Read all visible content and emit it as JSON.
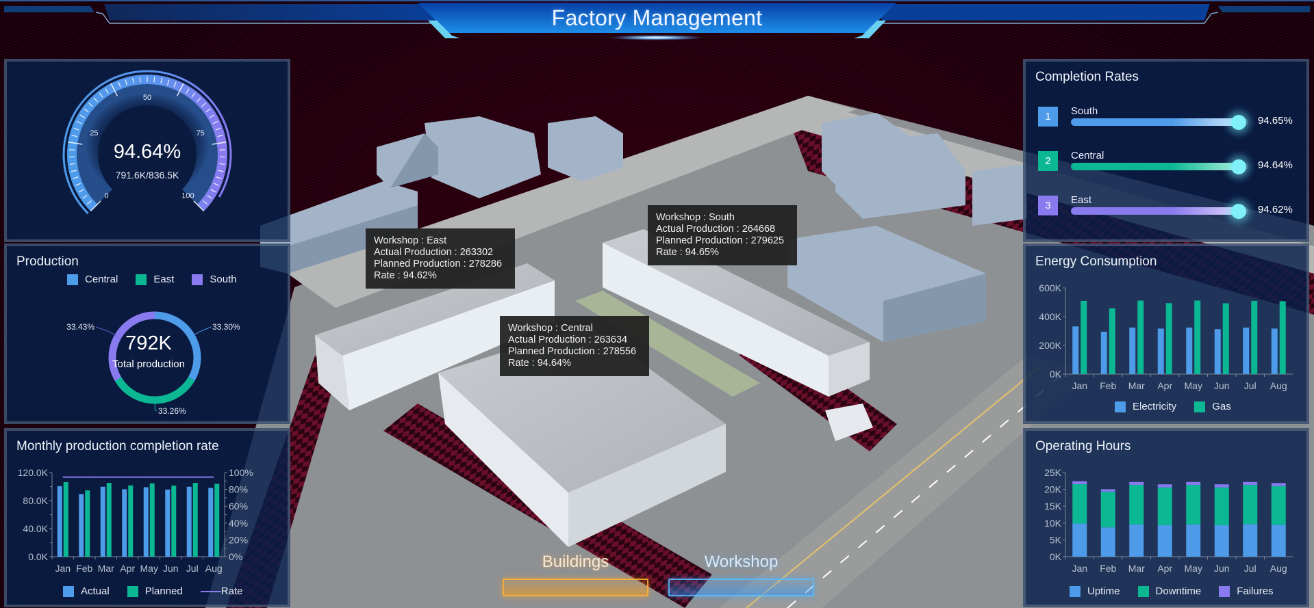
{
  "header": {
    "title": "Factory Management"
  },
  "colors": {
    "blue": "#4e9bea",
    "green": "#0cb894",
    "purple": "#8a7af0",
    "glow": "#7ff0f5",
    "panel": "#06204a"
  },
  "gauge": {
    "value_percent": 94.64,
    "value_label": "94.64%",
    "sub_label": "791.6K/836.5K",
    "ticks": [
      "0",
      "25",
      "50",
      "75",
      "100"
    ],
    "min": 0,
    "max": 100
  },
  "production": {
    "title": "Production",
    "legend": [
      "Central",
      "East",
      "South"
    ],
    "total_value": "792K",
    "total_label": "Total production",
    "slices": [
      {
        "name": "Central",
        "percent": 33.3,
        "label": "33.30%"
      },
      {
        "name": "East",
        "percent": 33.26,
        "label": "33.26%"
      },
      {
        "name": "South",
        "percent": 33.43,
        "label": "33.43%"
      }
    ]
  },
  "monthly": {
    "title": "Monthly production completion rate",
    "legend": {
      "actual": "Actual",
      "planned": "Planned",
      "rate": "Rate"
    }
  },
  "completion": {
    "title": "Completion Rates",
    "items": [
      {
        "rank": "1",
        "name": "South",
        "value": 94.65,
        "label": "94.65%"
      },
      {
        "rank": "2",
        "name": "Central",
        "value": 94.64,
        "label": "94.64%"
      },
      {
        "rank": "3",
        "name": "East",
        "value": 94.62,
        "label": "94.62%"
      }
    ]
  },
  "energy": {
    "title": "Energy Consumption",
    "legend": {
      "electricity": "Electricity",
      "gas": "Gas"
    }
  },
  "hours": {
    "title": "Operating Hours",
    "legend": {
      "uptime": "Uptime",
      "downtime": "Downtime",
      "failures": "Failures"
    }
  },
  "tooltips": [
    {
      "workshop": "Workshop : East",
      "actual": "Actual Production : 263302",
      "planned": "Planned Production : 278286",
      "rate": "Rate : 94.62%"
    },
    {
      "workshop": "Workshop : South",
      "actual": "Actual Production : 264668",
      "planned": "Planned Production : 279625",
      "rate": "Rate : 94.65%"
    },
    {
      "workshop": "Workshop : Central",
      "actual": "Actual Production : 263634",
      "planned": "Planned Production : 278556",
      "rate": "Rate : 94.64%"
    }
  ],
  "scene_buttons": {
    "buildings": "Buildings",
    "workshop": "Workshop"
  },
  "chart_data": [
    {
      "type": "pie",
      "title": "Production",
      "categories": [
        "Central",
        "East",
        "South"
      ],
      "values": [
        33.3,
        33.26,
        33.43
      ],
      "center_text": "792K",
      "center_subtext": "Total production",
      "legend": "top"
    },
    {
      "type": "bar",
      "title": "Monthly production completion rate",
      "categories": [
        "Jan",
        "Feb",
        "Mar",
        "Apr",
        "May",
        "Jun",
        "Jul",
        "Aug"
      ],
      "series": [
        {
          "name": "Actual",
          "values": [
            100.7,
            89.4,
            99.8,
            96.2,
            99.1,
            95.8,
            99.8,
            98.2
          ]
        },
        {
          "name": "Planned",
          "values": [
            106.3,
            94.6,
            105.3,
            101.7,
            104.6,
            101.4,
            105.3,
            104.0
          ]
        },
        {
          "name": "Rate",
          "type": "line",
          "axis": "right",
          "values": [
            94.6,
            94.6,
            94.6,
            94.6,
            94.6,
            94.6,
            94.6,
            94.6
          ]
        }
      ],
      "yticks": [
        "0.0K",
        "40.0K",
        "80.0K",
        "120.0K"
      ],
      "y2ticks": [
        "0%",
        "20%",
        "40%",
        "60%",
        "80%",
        "100%"
      ],
      "ylim": [
        0,
        120
      ],
      "y2lim": [
        0,
        100
      ],
      "yunit": "K",
      "legend": "bottom"
    },
    {
      "type": "bar",
      "title": "Energy Consumption",
      "categories": [
        "Jan",
        "Feb",
        "Mar",
        "Apr",
        "May",
        "Jun",
        "Jul",
        "Aug"
      ],
      "series": [
        {
          "name": "Electricity",
          "values": [
            332,
            295,
            324,
            317,
            324,
            313,
            324,
            317
          ]
        },
        {
          "name": "Gas",
          "values": [
            510,
            458,
            512,
            494,
            512,
            493,
            510,
            508
          ]
        }
      ],
      "yticks": [
        "0K",
        "200K",
        "400K",
        "600K"
      ],
      "ylim": [
        0,
        600
      ],
      "yunit": "K",
      "legend": "bottom"
    },
    {
      "type": "bar",
      "stacked": true,
      "title": "Operating Hours",
      "categories": [
        "Jan",
        "Feb",
        "Mar",
        "Apr",
        "May",
        "Jun",
        "Jul",
        "Aug"
      ],
      "series": [
        {
          "name": "Uptime",
          "values": [
            9.85,
            8.7,
            9.6,
            9.35,
            9.6,
            9.35,
            9.7,
            9.5
          ]
        },
        {
          "name": "Downtime",
          "values": [
            11.7,
            10.65,
            11.75,
            11.25,
            11.75,
            11.25,
            11.65,
            11.5
          ]
        },
        {
          "name": "Failures",
          "values": [
            0.9,
            0.7,
            0.85,
            0.9,
            0.85,
            0.9,
            0.85,
            0.9
          ]
        }
      ],
      "yticks": [
        "0K",
        "5K",
        "10K",
        "15K",
        "20K",
        "25K"
      ],
      "ylim": [
        0,
        25
      ],
      "yunit": "K",
      "legend": "bottom"
    }
  ]
}
